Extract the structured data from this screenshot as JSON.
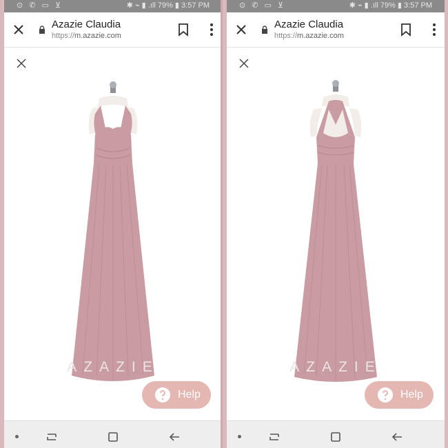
{
  "screens": [
    {
      "status": {
        "left_icons": "⊙ ✆ ▭ ⊻",
        "right_text": "✱ ⌁ ▮ .ıll 79% ▮ 3:57 PM"
      },
      "browser": {
        "title": "Azazie Claudia",
        "url_scheme": "https://",
        "url_host": "m.azazie.com"
      },
      "watermark": "AZAZIE",
      "help_label": "Help",
      "view": "front"
    },
    {
      "status": {
        "left_icons": "⊙ ✆ ▭ ⊻",
        "right_text": "✱ ⌁ ▮ .ıll 79% ▮ 3:57 PM"
      },
      "browser": {
        "title": "Azazie Claudia",
        "url_scheme": "https://",
        "url_host": "m.azazie.com"
      },
      "watermark": "AZAZIE",
      "help_label": "Help",
      "view": "back"
    }
  ],
  "colors": {
    "dress": "#c99ca3",
    "dress_shadow": "#b3878e",
    "help_button": "#e4b7b2",
    "status_bar": "#8a8a8a"
  }
}
